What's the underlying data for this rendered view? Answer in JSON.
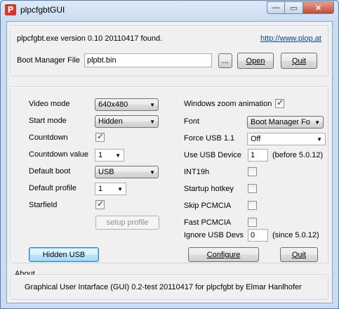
{
  "window": {
    "title": "plpcfgbtGUI",
    "app_icon": "P"
  },
  "titlebar_buttons": {
    "minimize": "—",
    "maximize": "▭",
    "close": "✕"
  },
  "top": {
    "status": "plpcfgbt.exe version 0.10 20110417 found.",
    "link": "http://www.plop.at",
    "boot_manager_label": "Boot Manager File",
    "boot_manager_value": "plpbt.bin",
    "browse": "...",
    "open": "Open",
    "quit": "Quit"
  },
  "left": {
    "video_mode_label": "Video mode",
    "video_mode_value": "640x480",
    "start_mode_label": "Start mode",
    "start_mode_value": "Hidden",
    "countdown_label": "Countdown",
    "countdown_checked": true,
    "countdown_value_label": "Countdown value",
    "countdown_value": "1",
    "default_boot_label": "Default boot",
    "default_boot_value": "USB",
    "default_profile_label": "Default profile",
    "default_profile_value": "1",
    "starfield_label": "Starfield",
    "starfield_checked": true,
    "setup_profile": "setup profile"
  },
  "right": {
    "zoom_label": "Windows zoom animation",
    "zoom_checked": true,
    "font_label": "Font",
    "font_value": "Boot Manager Fo",
    "force_usb_label": "Force USB 1.1",
    "force_usb_value": "Off",
    "use_usb_device_label": "Use USB Device",
    "use_usb_device_value": "1",
    "use_usb_device_note": "(before 5.0.12)",
    "int19h_label": "INT19h",
    "int19h_checked": false,
    "startup_hotkey_label": "Startup hotkey",
    "startup_hotkey_checked": false,
    "skip_pcmcia_label": "Skip PCMCIA",
    "skip_pcmcia_checked": false,
    "fast_pcmcia_label": "Fast PCMCIA",
    "fast_pcmcia_checked": false,
    "ignore_usb_label": "Ignore USB Devs",
    "ignore_usb_value": "0",
    "ignore_usb_note": "(since 5.0.12)"
  },
  "bottom_buttons": {
    "hidden_usb": "Hidden USB",
    "configure": "Configure",
    "quit": "Quit"
  },
  "about": {
    "label": "About",
    "text": "Graphical User Intarface (GUI) 0.2-test 20110417 for plpcfgbt by Elmar Hanlhofer"
  }
}
